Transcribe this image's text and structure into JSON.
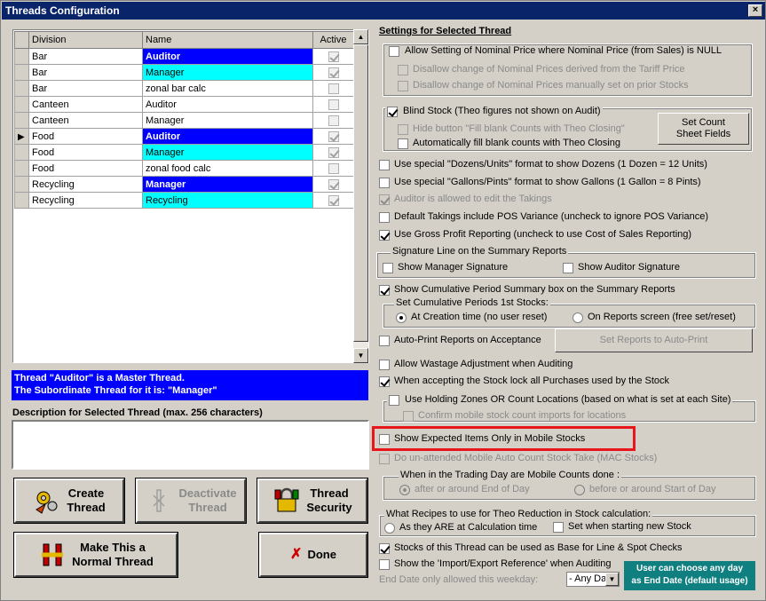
{
  "window": {
    "title": "Threads Configuration",
    "close": "×"
  },
  "grid": {
    "headers": [
      "Division",
      "Name",
      "Active"
    ],
    "rows": [
      {
        "division": "Bar",
        "name": "Auditor",
        "style": "blue",
        "active": true,
        "current": false
      },
      {
        "division": "Bar",
        "name": "Manager",
        "style": "cyan",
        "active": true,
        "current": false
      },
      {
        "division": "Bar",
        "name": "zonal bar calc",
        "style": "",
        "active": false,
        "current": false
      },
      {
        "division": "Canteen",
        "name": "Auditor",
        "style": "",
        "active": false,
        "current": false
      },
      {
        "division": "Canteen",
        "name": "Manager",
        "style": "",
        "active": false,
        "current": false
      },
      {
        "division": "Food",
        "name": "Auditor",
        "style": "blue",
        "active": true,
        "current": true
      },
      {
        "division": "Food",
        "name": "Manager",
        "style": "cyan",
        "active": true,
        "current": false
      },
      {
        "division": "Food",
        "name": "zonal food calc",
        "style": "",
        "active": false,
        "current": false
      },
      {
        "division": "Recycling",
        "name": "Manager",
        "style": "blue",
        "active": true,
        "current": false
      },
      {
        "division": "Recycling",
        "name": "Recycling",
        "style": "cyan",
        "active": true,
        "current": false
      }
    ]
  },
  "master_info": {
    "line1": "Thread \"Auditor\" is a Master Thread.",
    "line2": "The Subordinate Thread for it is: \"Manager\""
  },
  "description": {
    "label": "Description for Selected Thread (max. 256 characters)",
    "value": ""
  },
  "buttons": {
    "create": [
      "Create",
      "Thread"
    ],
    "deactivate": [
      "Deactivate",
      "Thread"
    ],
    "security": [
      "Thread",
      "Security"
    ],
    "normal": [
      "Make This a",
      "Normal Thread"
    ],
    "done": "Done"
  },
  "settings": {
    "title": "Settings for Selected Thread",
    "allow_nominal": "Allow Setting of Nominal Price where Nominal Price (from Sales) is NULL",
    "disallow_tariff": "Disallow change of Nominal Prices derived from the Tariff Price",
    "disallow_manual": "Disallow change of Nominal Prices manually set on prior Stocks",
    "blind_stock": "Blind Stock (Theo figures not shown on Audit)",
    "hide_fill": "Hide button \"Fill blank Counts with Theo Closing\"",
    "auto_fill": "Automatically fill blank counts with Theo Closing",
    "set_count_sheet": [
      "Set Count",
      "Sheet Fields"
    ],
    "dozens": "Use special \"Dozens/Units\" format to show Dozens (1 Dozen = 12 Units)",
    "gallons": "Use special \"Gallons/Pints\" format to show Gallons (1 Gallon = 8 Pints)",
    "auditor_takings": "Auditor is allowed to edit the Takings",
    "default_takings": "Default Takings include POS Variance (uncheck to ignore POS Variance)",
    "gross_profit": "Use Gross Profit Reporting (uncheck to use Cost of Sales Reporting)",
    "signature_group": "Signature Line on the Summary Reports",
    "show_manager_sig": "Show Manager Signature",
    "show_auditor_sig": "Show Auditor Signature",
    "cumulative_box": "Show Cumulative Period Summary box on the Summary Reports",
    "cumulative_group": "Set Cumulative Periods 1st Stocks:",
    "at_creation": "At Creation time (no user reset)",
    "on_reports": "On Reports screen (free set/reset)",
    "auto_print": "Auto-Print Reports on Acceptance",
    "set_auto_print": "Set Reports to Auto-Print",
    "wastage": "Allow Wastage Adjustment when Auditing",
    "stock_lock": "When accepting the Stock lock all Purchases used by the Stock",
    "holding_zones": "Use Holding Zones OR Count Locations (based on what is set at each Site)",
    "confirm_mobile": "Confirm mobile stock count imports for locations",
    "expected_items": "Show Expected Items Only in Mobile Stocks",
    "mac_stocks": "Do un-attended Mobile Auto Count Stock Take (MAC Stocks)",
    "trading_group": "When in the Trading Day are Mobile Counts done :",
    "after_end": "after or around End of Day",
    "before_start": "before or around Start of Day",
    "recipes_group": "What Recipes to use for Theo Reduction in Stock calculation:",
    "as_they_are": "As they ARE at Calculation time",
    "set_when_new": "Set when starting new Stock",
    "base_checks": "Stocks of this Thread can be used as Base for Line & Spot Checks",
    "import_export": "Show the 'Import/Export Reference' when Auditing",
    "end_date": "End Date only allowed this weekday:",
    "weekday": "- Any Day -",
    "teal_note": [
      "User can choose any day",
      "as End Date (default usage)"
    ]
  },
  "colors": {
    "title_bar": "#0a246a",
    "selection_blue": "#0000ff",
    "cyan": "#00ffff",
    "highlight": "#e8161b",
    "teal": "#0f7f7f"
  }
}
